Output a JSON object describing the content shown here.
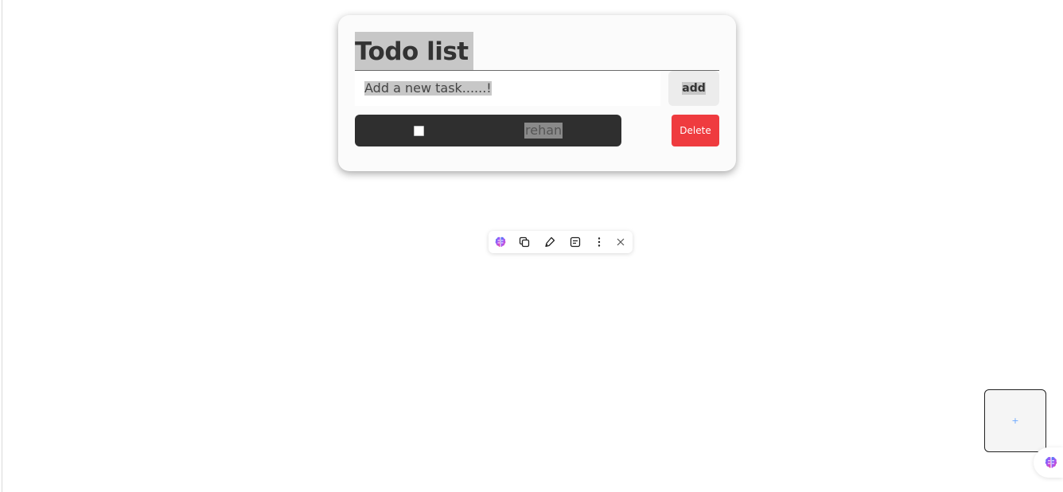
{
  "app": {
    "title": "Todo list"
  },
  "input": {
    "placeholder": "Add a new task......!"
  },
  "add_button": {
    "label": "add"
  },
  "tasks": [
    {
      "text": "rehan",
      "checked": false,
      "delete_label": "Delete"
    }
  ],
  "floating_toolbar": {
    "icons": [
      "brain-icon",
      "copy-icon",
      "pen-icon",
      "note-icon",
      "more-vertical-icon",
      "close-icon"
    ]
  },
  "bottom_box": {
    "symbol": "+"
  },
  "colors": {
    "delete": "#ef3b3f",
    "task_row": "#2f2f2f",
    "selection_highlight": "#c7c7c7",
    "plus": "#6aa8ff"
  }
}
